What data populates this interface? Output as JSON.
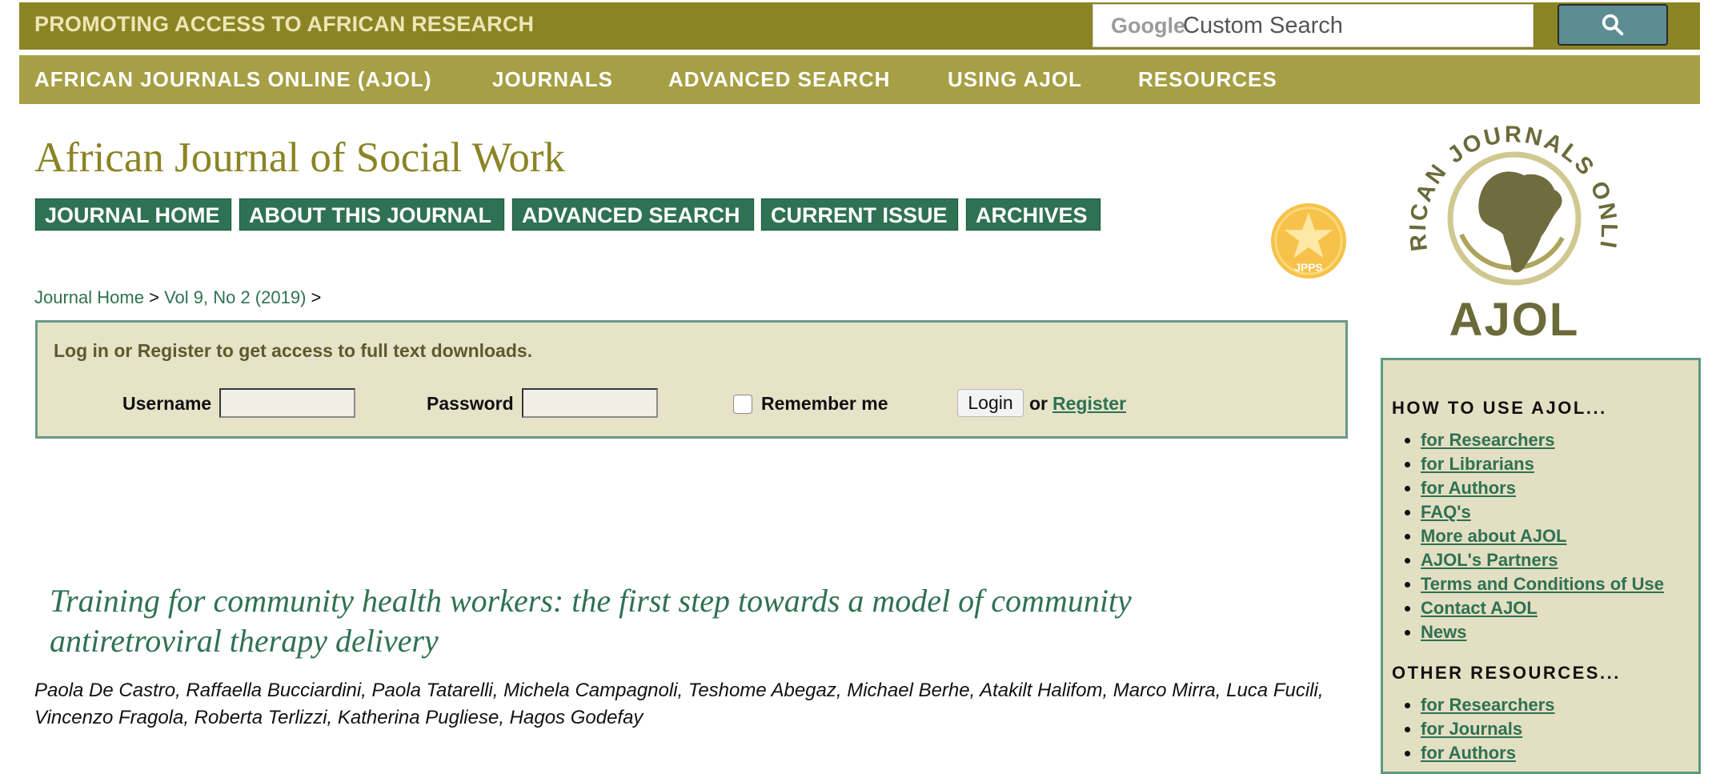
{
  "header": {
    "tagline": "PROMOTING ACCESS TO AFRICAN RESEARCH",
    "search": {
      "brand": "Google",
      "placeholder": "Custom Search",
      "icon": "search-icon"
    }
  },
  "main_nav": {
    "items": [
      {
        "label": "AFRICAN JOURNALS ONLINE (AJOL)"
      },
      {
        "label": "JOURNALS"
      },
      {
        "label": "ADVANCED SEARCH"
      },
      {
        "label": "USING AJOL"
      },
      {
        "label": "RESOURCES"
      }
    ]
  },
  "journal": {
    "title": "African Journal of Social Work",
    "tabs": [
      {
        "label": "JOURNAL HOME"
      },
      {
        "label": "ABOUT THIS JOURNAL"
      },
      {
        "label": "ADVANCED SEARCH"
      },
      {
        "label": "CURRENT ISSUE"
      },
      {
        "label": "ARCHIVES"
      }
    ],
    "badge": "JPPS"
  },
  "breadcrumb": {
    "home": "Journal Home",
    "sep": ">",
    "issue": "Vol 9, No 2 (2019)"
  },
  "login": {
    "message": "Log in or Register to get access to full text downloads.",
    "username_label": "Username",
    "password_label": "Password",
    "remember_label": "Remember me",
    "login_button": "Login",
    "or_text": "or",
    "register_link": "Register"
  },
  "article": {
    "title": "Training for community health workers: the first step towards a model of community antiretroviral therapy delivery",
    "authors": "Paola De Castro, Raffaella Bucciardini, Paola Tatarelli, Michela Campagnoli, Teshome Abegaz, Michael Berhe, Atakilt Halifom, Marco Mirra, Luca Fucili, Vincenzo Fragola, Roberta Terlizzi, Katherina Pugliese, Hagos Godefay"
  },
  "logo": {
    "arc_text": "AFRICAN JOURNALS ONLINE",
    "wordmark": "AJOL"
  },
  "sidebar": {
    "how_to_heading": "HOW TO USE AJOL...",
    "how_to_links": [
      "for Researchers",
      "for Librarians",
      "for Authors",
      "FAQ's",
      "More about AJOL",
      "AJOL's Partners",
      "Terms and Conditions of Use",
      "Contact AJOL",
      "News"
    ],
    "other_heading": "OTHER RESOURCES...",
    "other_links": [
      "for Researchers",
      "for Journals",
      "for Authors"
    ]
  },
  "colors": {
    "olive": "#8b8424",
    "olive_light": "#a69f45",
    "green": "#2f7153",
    "panel": "#e6e3c8"
  }
}
